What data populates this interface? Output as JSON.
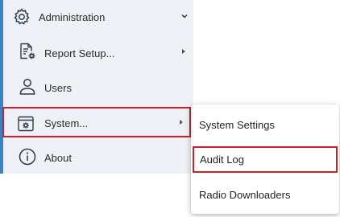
{
  "menu": {
    "accent_color": "#3b82c4",
    "highlight_color": "#d11f2a",
    "items": [
      {
        "label": "Administration",
        "icon": "gear-icon",
        "expanded": true
      },
      {
        "label": "Report Setup...",
        "icon": "report-settings-icon",
        "has_submenu": true
      },
      {
        "label": "Users",
        "icon": "user-icon"
      },
      {
        "label": "System...",
        "icon": "system-window-gear-icon",
        "has_submenu": true,
        "highlighted": true
      },
      {
        "label": "About",
        "icon": "info-icon"
      }
    ]
  },
  "submenu": {
    "items": [
      {
        "label": "System Settings"
      },
      {
        "label": "Audit Log",
        "highlighted": true
      },
      {
        "label": "Radio Downloaders"
      }
    ]
  }
}
